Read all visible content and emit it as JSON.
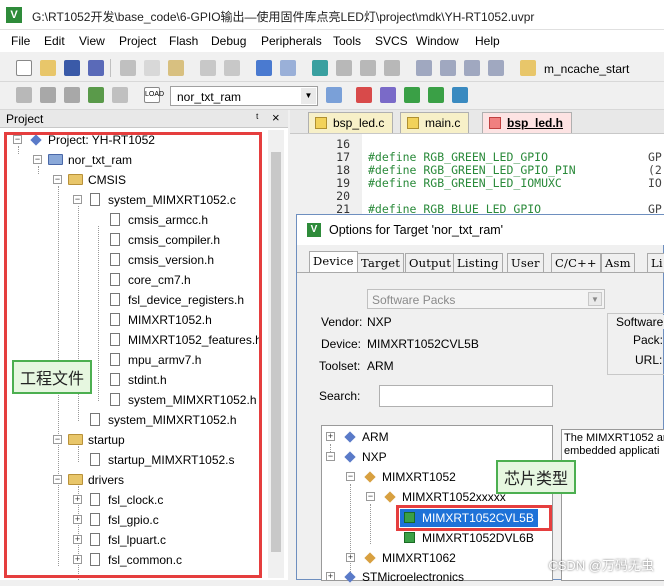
{
  "app": {
    "title": "G:\\RT1052开发\\base_code\\6-GPIO输出—使用固件库点亮LED灯\\project\\mdk\\YH-RT1052.uvpr"
  },
  "menu": [
    "File",
    "Edit",
    "View",
    "Project",
    "Flash",
    "Debug",
    "Peripherals",
    "Tools",
    "SVCS",
    "Window",
    "Help"
  ],
  "toolbar": {
    "function_name": "m_ncache_start",
    "target": "nor_txt_ram"
  },
  "project_panel": {
    "header": "Project",
    "pin": "ᵗ",
    "close": "×",
    "root": "Project: YH-RT1052",
    "target": "nor_txt_ram",
    "groups": {
      "cmsis": "CMSIS",
      "system_c": "system_MIMXRT1052.c",
      "cmsis_files": [
        "cmsis_armcc.h",
        "cmsis_compiler.h",
        "cmsis_version.h",
        "core_cm7.h",
        "fsl_device_registers.h",
        "MIMXRT1052.h",
        "MIMXRT1052_features.h",
        "mpu_armv7.h",
        "stdint.h",
        "system_MIMXRT1052.h"
      ],
      "system_h": "system_MIMXRT1052.h",
      "startup": "startup",
      "startup_file": "startup_MIMXRT1052.s",
      "drivers": "drivers",
      "driver_files": [
        "fsl_clock.c",
        "fsl_gpio.c",
        "fsl_lpuart.c",
        "fsl_common.c"
      ]
    }
  },
  "editor": {
    "tabs": [
      "bsp_led.c",
      "main.c",
      "bsp_led.h"
    ],
    "lines": [
      {
        "n": "16",
        "code": ""
      },
      {
        "n": "17",
        "code": "#define RGB_GREEN_LED_GPIO",
        "tail": "GP"
      },
      {
        "n": "18",
        "code": "#define RGB_GREEN_LED_GPIO_PIN",
        "tail": "(2"
      },
      {
        "n": "19",
        "code": "#define RGB_GREEN_LED_IOMUXC",
        "tail": "IO"
      },
      {
        "n": "20",
        "code": ""
      },
      {
        "n": "21",
        "code": "#define RGB_BLUE_LED_GPIO",
        "tail": "GP"
      }
    ]
  },
  "dialog": {
    "title": "Options for Target 'nor_txt_ram'",
    "tabs": [
      "Device",
      "Target",
      "Output",
      "Listing",
      "User",
      "C/C++",
      "Asm",
      "Li"
    ],
    "packs_value": "Software Packs",
    "vendor_label": "Vendor:",
    "vendor": "NXP",
    "device_label": "Device:",
    "device": "MIMXRT1052CVL5B",
    "toolset_label": "Toolset:",
    "toolset": "ARM",
    "search_label": "Search:",
    "side_panel_title": "Software P",
    "pack_label": "Pack:",
    "url_label": "URL:",
    "tree": [
      "ARM",
      "NXP",
      "MIMXRT1052",
      "MIMXRT1052xxxxx",
      "MIMXRT1052CVL5B",
      "MIMXRT1052DVL6B",
      "MIMXRT1062",
      "STMicroelectronics"
    ],
    "description": [
      "The MIMXRT1052 ar",
      "embedded applicati"
    ]
  },
  "annotations": {
    "project_files": "工程文件",
    "chip_type": "芯片类型"
  },
  "watermark": "CSDN @万码无虫"
}
